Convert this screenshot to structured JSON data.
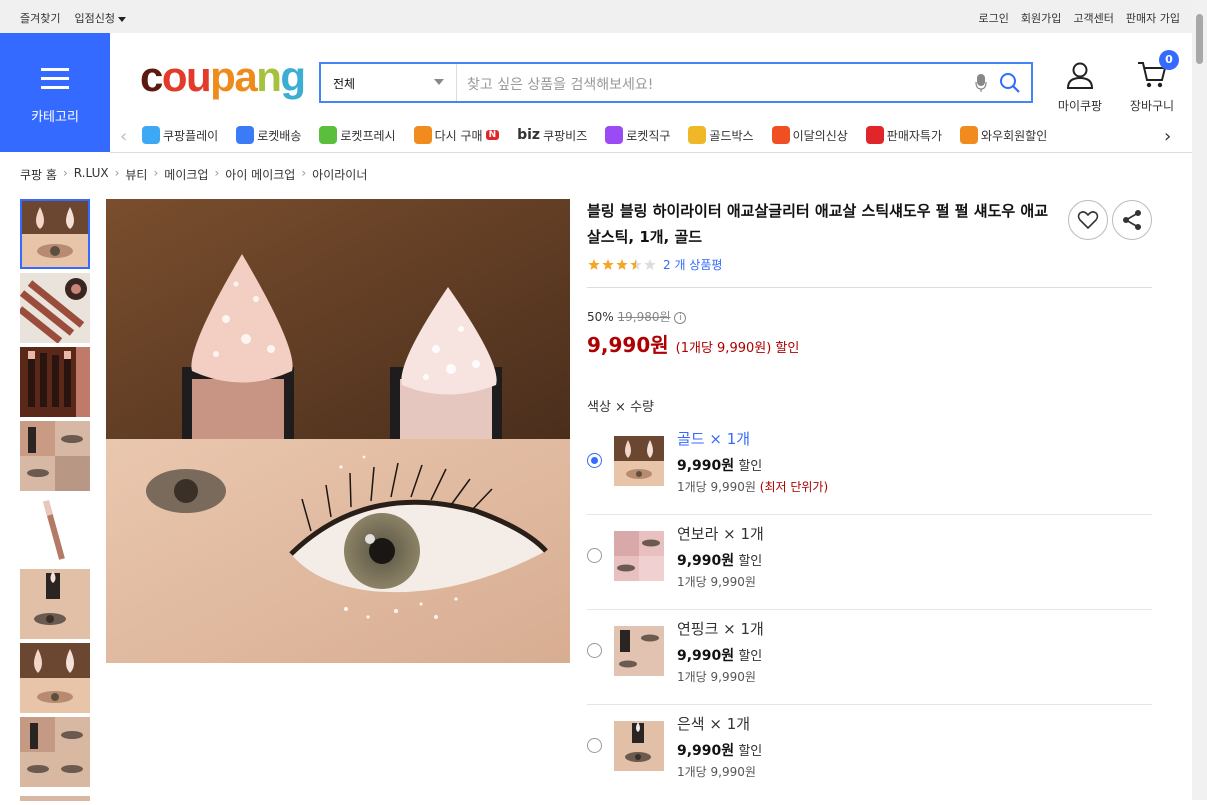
{
  "topbar": {
    "left": [
      "즐겨찾기",
      "입점신청"
    ],
    "right": [
      "로그인",
      "회원가입",
      "고객센터",
      "판매자 가입"
    ]
  },
  "header": {
    "category_label": "카테고리",
    "logo": "coupang",
    "logo_colors": [
      "#5b1a10",
      "#e23b29",
      "#ef8b1c",
      "#a4c23e",
      "#3caed1"
    ],
    "search_scope": "전체",
    "search_placeholder": "찾고 싶은 상품을 검색해보세요!",
    "mycoupang": "마이쿠팡",
    "cart": "장바구니",
    "cart_count": "0"
  },
  "nav": [
    {
      "label": "쿠팡플레이",
      "icon": "play-icon",
      "color": "#3da9f5"
    },
    {
      "label": "로켓배송",
      "icon": "rocket-icon",
      "color": "#3b7bf5"
    },
    {
      "label": "로켓프레시",
      "icon": "fresh-rocket-icon",
      "color": "#5bbf3d"
    },
    {
      "label": "다시 구매",
      "icon": "rebuy-icon",
      "color": "#f28b1e",
      "badge": "N"
    },
    {
      "label": "쿠팡비즈",
      "icon": "biz-icon",
      "color": "#333333",
      "prefix": "biz"
    },
    {
      "label": "로켓직구",
      "icon": "global-rocket-icon",
      "color": "#9b4bf5"
    },
    {
      "label": "골드박스",
      "icon": "goldbox-icon",
      "color": "#f0b828"
    },
    {
      "label": "이달의신상",
      "icon": "new-bag-icon",
      "color": "#f04e23"
    },
    {
      "label": "판매자특가",
      "icon": "percent-icon",
      "color": "#e0262b"
    },
    {
      "label": "와우회원할인",
      "icon": "wow-icon",
      "color": "#f28b1e"
    }
  ],
  "breadcrumb": [
    "쿠팡 홈",
    "R.LUX",
    "뷰티",
    "메이크업",
    "아이 메이크업",
    "아이라이너"
  ],
  "product": {
    "title": "블링 블링 하이라이터 애교살글리터 애교살 스틱섀도우 펄 펄 섀도우 애교살스틱, 1개, 골드",
    "rating": 3.5,
    "review_count_text": "2 개 상품평",
    "discount": "50%",
    "original_price": "19,980원",
    "sale_price": "9,990원",
    "unit_price_text": "(1개당 9,990원) 할인",
    "option_label": "색상 × 수량"
  },
  "options": [
    {
      "name": "골드 × 1개",
      "price": "9,990원",
      "discount_label": "할인",
      "unit": "1개당 9,990원",
      "lowest": "(최저 단위가)",
      "selected": true
    },
    {
      "name": "연보라 × 1개",
      "price": "9,990원",
      "discount_label": "할인",
      "unit": "1개당 9,990원",
      "lowest": "",
      "selected": false
    },
    {
      "name": "연핑크 × 1개",
      "price": "9,990원",
      "discount_label": "할인",
      "unit": "1개당 9,990원",
      "lowest": "",
      "selected": false
    },
    {
      "name": "은색 × 1개",
      "price": "9,990원",
      "discount_label": "할인",
      "unit": "1개당 9,990원",
      "lowest": "",
      "selected": false
    }
  ]
}
